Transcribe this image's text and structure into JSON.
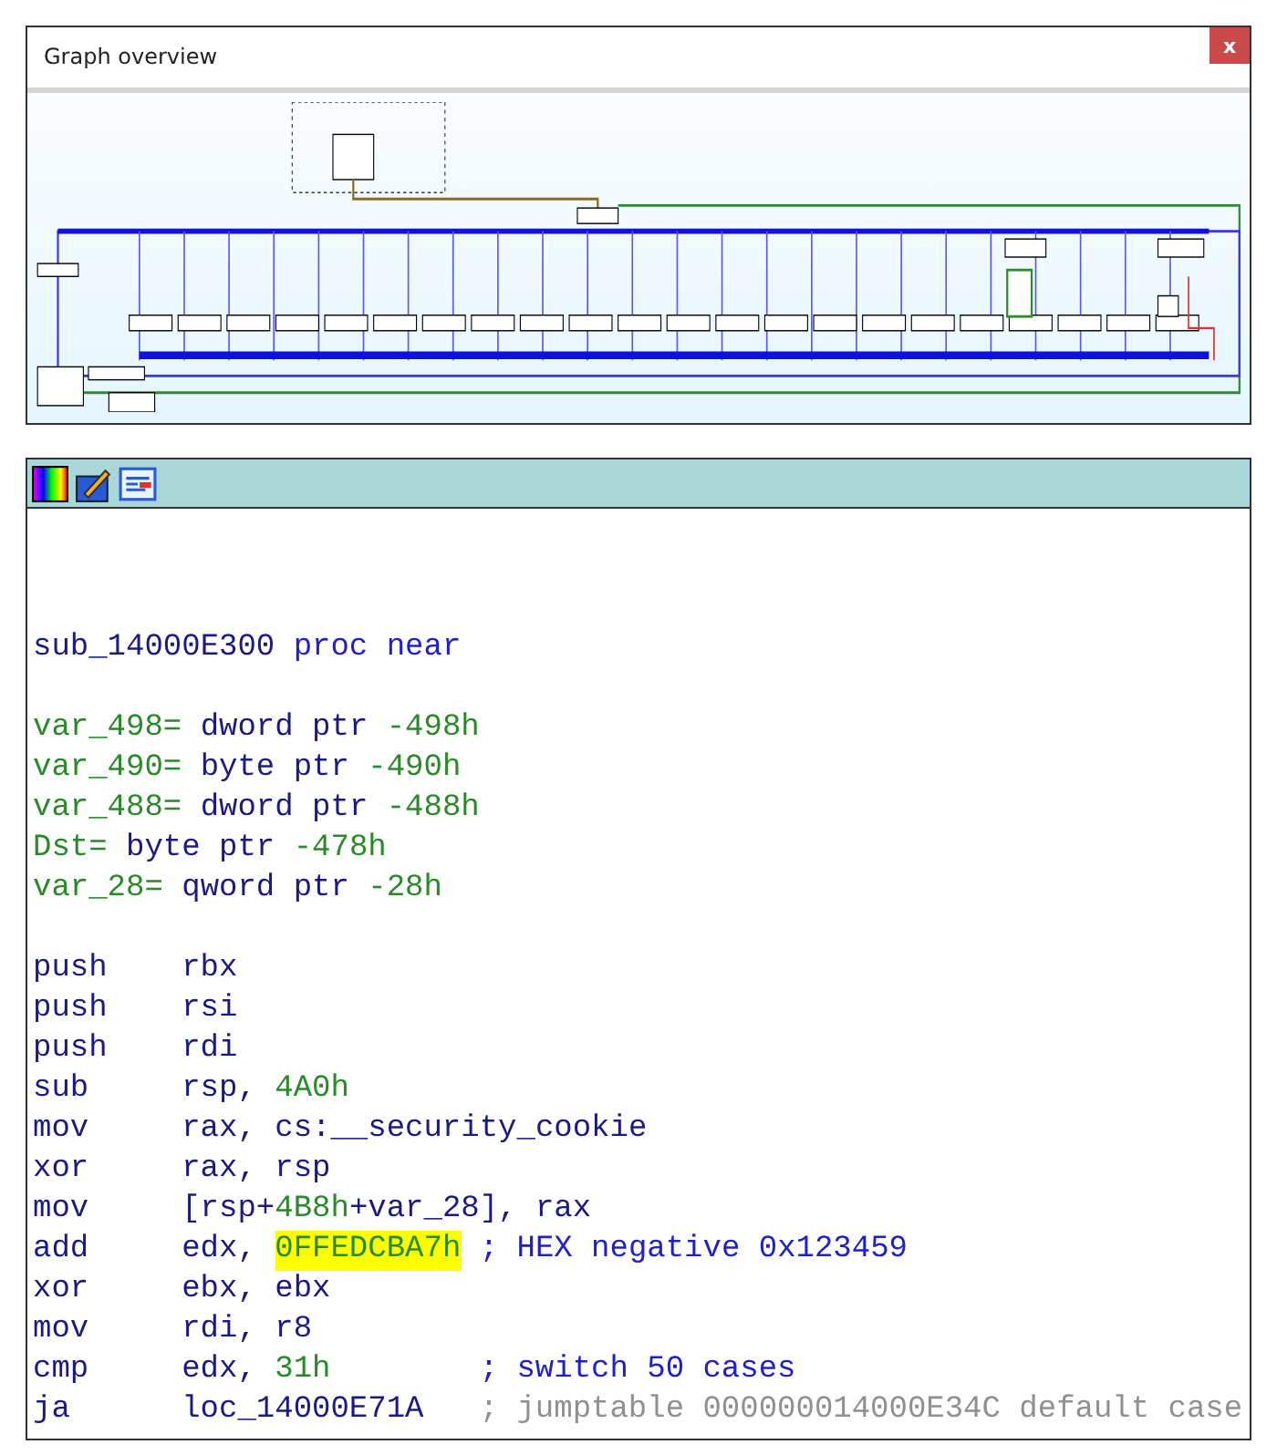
{
  "graph_overview": {
    "title": "Graph overview",
    "close_label": "x"
  },
  "disassembly": {
    "header": [
      {
        "segments": [
          {
            "text": "sub_14000E300",
            "kind": "name"
          },
          {
            "text": " proc near",
            "kind": "keyword"
          }
        ]
      }
    ],
    "locals": [
      {
        "segments": [
          {
            "text": "var_498=",
            "kind": "var"
          },
          {
            "text": " dword ptr ",
            "kind": "plain"
          },
          {
            "text": "-498h",
            "kind": "number"
          }
        ]
      },
      {
        "segments": [
          {
            "text": "var_490=",
            "kind": "var"
          },
          {
            "text": " byte ptr ",
            "kind": "plain"
          },
          {
            "text": "-490h",
            "kind": "number"
          }
        ]
      },
      {
        "segments": [
          {
            "text": "var_488=",
            "kind": "var"
          },
          {
            "text": " dword ptr ",
            "kind": "plain"
          },
          {
            "text": "-488h",
            "kind": "number"
          }
        ]
      },
      {
        "segments": [
          {
            "text": "Dst=",
            "kind": "var"
          },
          {
            "text": " byte ptr ",
            "kind": "plain"
          },
          {
            "text": "-478h",
            "kind": "number"
          }
        ]
      },
      {
        "segments": [
          {
            "text": "var_28=",
            "kind": "var"
          },
          {
            "text": " qword ptr ",
            "kind": "plain"
          },
          {
            "text": "-28h",
            "kind": "number"
          }
        ]
      }
    ],
    "instructions": [
      {
        "mnemonic": "push",
        "operands": [
          {
            "text": "rbx",
            "kind": "plain"
          }
        ]
      },
      {
        "mnemonic": "push",
        "operands": [
          {
            "text": "rsi",
            "kind": "plain"
          }
        ]
      },
      {
        "mnemonic": "push",
        "operands": [
          {
            "text": "rdi",
            "kind": "plain"
          }
        ]
      },
      {
        "mnemonic": "sub",
        "operands": [
          {
            "text": "rsp, ",
            "kind": "plain"
          },
          {
            "text": "4A0h",
            "kind": "number"
          }
        ]
      },
      {
        "mnemonic": "mov",
        "operands": [
          {
            "text": "rax, cs:__security_cookie",
            "kind": "plain"
          }
        ]
      },
      {
        "mnemonic": "xor",
        "operands": [
          {
            "text": "rax, rsp",
            "kind": "plain"
          }
        ]
      },
      {
        "mnemonic": "mov",
        "operands": [
          {
            "text": "[rsp+",
            "kind": "plain"
          },
          {
            "text": "4B8h",
            "kind": "number"
          },
          {
            "text": "+var_28], rax",
            "kind": "plain"
          }
        ]
      },
      {
        "mnemonic": "add",
        "operands": [
          {
            "text": "edx, ",
            "kind": "plain"
          },
          {
            "text": "0FFEDCBA7h",
            "kind": "highlight"
          }
        ],
        "comment": {
          "text": "; HEX negative 0x123459",
          "kind": "user"
        }
      },
      {
        "mnemonic": "xor",
        "operands": [
          {
            "text": "ebx, ebx",
            "kind": "plain"
          }
        ]
      },
      {
        "mnemonic": "mov",
        "operands": [
          {
            "text": "rdi, r8",
            "kind": "plain"
          }
        ]
      },
      {
        "mnemonic": "cmp",
        "operands": [
          {
            "text": "edx, ",
            "kind": "plain"
          },
          {
            "text": "31h",
            "kind": "number"
          }
        ],
        "comment": {
          "text": "; switch 50 cases",
          "kind": "user"
        }
      },
      {
        "mnemonic": "ja",
        "operands": [
          {
            "text": "loc_14000E71A",
            "kind": "plain"
          }
        ],
        "comment": {
          "text": "; jumptable 000000014000E34C default case",
          "kind": "auto"
        }
      }
    ]
  }
}
